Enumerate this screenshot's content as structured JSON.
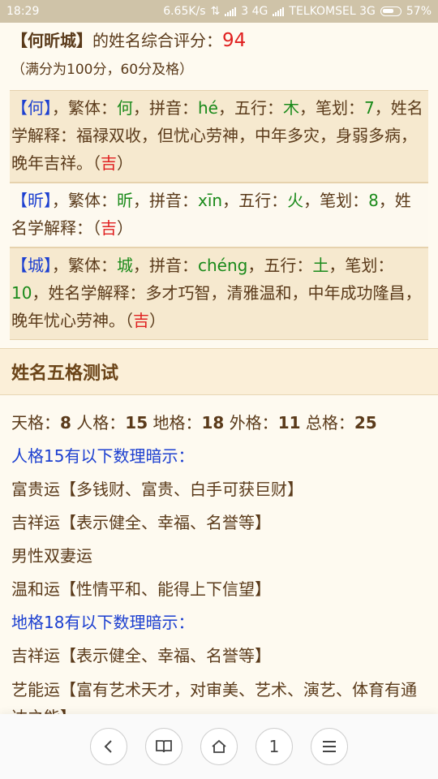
{
  "status_bar": {
    "time": "18:29",
    "speed": "6.65K/s",
    "network_info": "3 4G",
    "carrier": "TELKOMSEL 3G",
    "battery": "57%"
  },
  "summary": {
    "name_bracket": "【何昕城】",
    "text": "的姓名综合评分：",
    "score": "94",
    "note": "（满分为100分，60分及格）"
  },
  "characters": [
    {
      "bracket": "【何】",
      "trad_label": "，繁体：",
      "trad": "何",
      "pinyin_label": "，拼音：",
      "pinyin": "hé",
      "wuxing_label": "，五行：",
      "wuxing": "木",
      "strokes_label": "，笔划：",
      "strokes": "7",
      "explain": "，姓名学解释：福禄双收，但忧心劳神，中年多灾，身弱多病，晚年吉祥。",
      "luck_open": "（",
      "luck": "吉",
      "luck_close": "）"
    },
    {
      "bracket": "【昕】",
      "trad_label": "，繁体：",
      "trad": "昕",
      "pinyin_label": "，拼音：",
      "pinyin": "xīn",
      "wuxing_label": "，五行：",
      "wuxing": "火",
      "strokes_label": "，笔划：",
      "strokes": "8",
      "explain": "，姓名学解释：",
      "luck_open": "（",
      "luck": "吉",
      "luck_close": "）"
    },
    {
      "bracket": "【城】",
      "trad_label": "，繁体：",
      "trad": "城",
      "pinyin_label": "，拼音：",
      "pinyin": "chéng",
      "wuxing_label": "，五行：",
      "wuxing": "土",
      "strokes_label": "，笔划：",
      "strokes": "10",
      "explain": "，姓名学解释：多才巧智，清雅温和，中年成功隆昌，晚年忧心劳神。",
      "luck_open": "（",
      "luck": "吉",
      "luck_close": "）"
    }
  ],
  "wuge_section": {
    "title": "姓名五格测试",
    "grid": [
      {
        "label": "天格：",
        "value": "8"
      },
      {
        "label": "人格：",
        "value": "15"
      },
      {
        "label": "地格：",
        "value": "18"
      },
      {
        "label": "外格：",
        "value": "11"
      },
      {
        "label": "总格：",
        "value": "25"
      }
    ],
    "renge_title": "人格15有以下数理暗示：",
    "renge_items": [
      "富贵运【多钱财、富贵、白手可获巨财】",
      "吉祥运【表示健全、幸福、名誉等】",
      "男性双妻运",
      "温和运【性情平和、能得上下信望】"
    ],
    "dige_title": "地格18有以下数理暗示：",
    "dige_items": [
      "吉祥运【表示健全、幸福、名誉等】",
      "艺能运【富有艺术天才，对审美、艺术、演艺、体育有通达之能】"
    ]
  },
  "bottom_nav": {
    "page_count": "1"
  }
}
